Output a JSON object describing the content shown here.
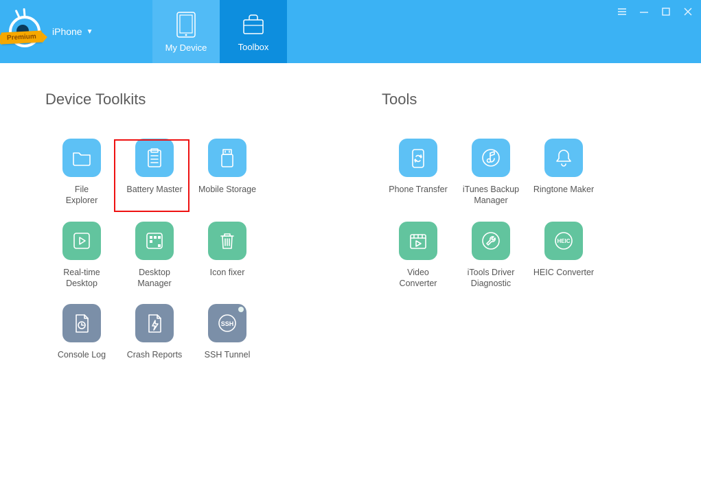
{
  "header": {
    "premium_badge": "Premium",
    "device_label": "iPhone",
    "tabs": {
      "my_device": "My Device",
      "toolbox": "Toolbox"
    },
    "active_tab": "toolbox"
  },
  "sections": {
    "device_toolkits": {
      "title": "Device Toolkits"
    },
    "tools": {
      "title": "Tools"
    }
  },
  "device_toolkits": [
    {
      "id": "file-explorer",
      "label": "File\nExplorer",
      "color": "blue",
      "icon": "folder"
    },
    {
      "id": "battery-master",
      "label": "Battery Master",
      "color": "blue",
      "icon": "clipboard",
      "highlighted": true
    },
    {
      "id": "mobile-storage",
      "label": "Mobile Storage",
      "color": "blue",
      "icon": "usb-drive"
    },
    {
      "id": "real-time-desktop",
      "label": "Real-time\nDesktop",
      "color": "green",
      "icon": "play"
    },
    {
      "id": "desktop-manager",
      "label": "Desktop\nManager",
      "color": "green",
      "icon": "grid"
    },
    {
      "id": "icon-fixer",
      "label": "Icon fixer",
      "color": "green",
      "icon": "trash"
    },
    {
      "id": "console-log",
      "label": "Console Log",
      "color": "slate",
      "icon": "doc-clock"
    },
    {
      "id": "crash-reports",
      "label": "Crash Reports",
      "color": "slate",
      "icon": "doc-bolt"
    },
    {
      "id": "ssh-tunnel",
      "label": "SSH Tunnel",
      "color": "slate",
      "icon": "ssh"
    }
  ],
  "tools": [
    {
      "id": "phone-transfer",
      "label": "Phone Transfer",
      "color": "blue",
      "icon": "phone-sync"
    },
    {
      "id": "itunes-backup-manager",
      "label": "iTunes Backup\nManager",
      "color": "blue",
      "icon": "music-sync"
    },
    {
      "id": "ringtone-maker",
      "label": "Ringtone Maker",
      "color": "blue",
      "icon": "bell"
    },
    {
      "id": "placeholder",
      "label": "",
      "color": "",
      "icon": "",
      "empty": true
    },
    {
      "id": "video-converter",
      "label": "Video\nConverter",
      "color": "green",
      "icon": "film"
    },
    {
      "id": "itools-driver-diag",
      "label": "iTools Driver\nDiagnostic",
      "color": "green",
      "icon": "wrench"
    },
    {
      "id": "heic-converter",
      "label": "HEIC Converter",
      "color": "green",
      "icon": "heic"
    }
  ]
}
